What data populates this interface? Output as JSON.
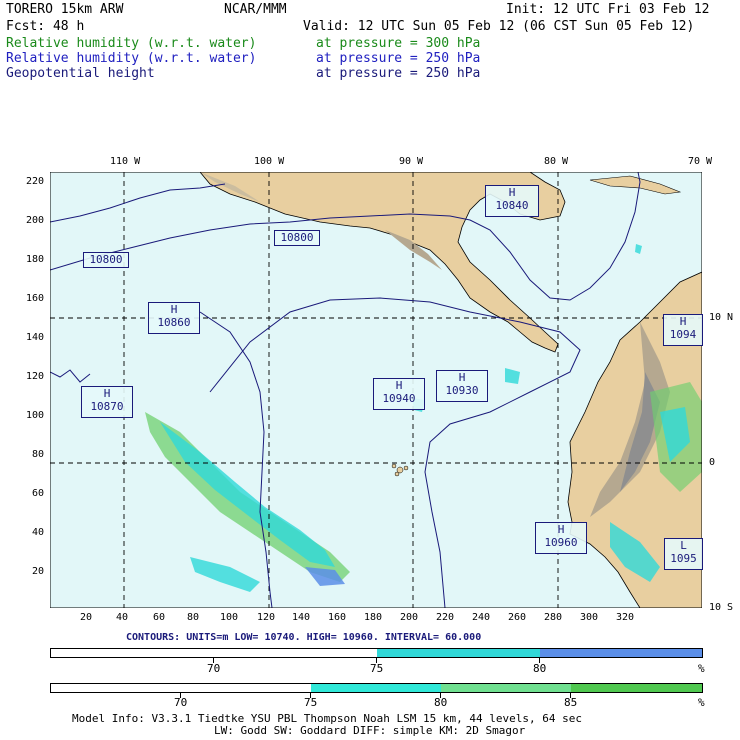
{
  "header": {
    "model": "TORERO  15km ARW",
    "org": "NCAR/MMM",
    "init": "Init: 12 UTC Fri 03 Feb 12",
    "fcst": "Fcst:   48 h",
    "valid": "Valid: 12 UTC Sun 05 Feb 12 (06 CST Sun 05 Feb 12)"
  },
  "fields": [
    {
      "name": "Relative humidity (w.r.t. water)",
      "level": "at pressure =  300 hPa",
      "color": "#1a8a1a"
    },
    {
      "name": "Relative humidity (w.r.t. water)",
      "level": "at pressure =  250 hPa",
      "color": "#2020c0"
    },
    {
      "name": "Geopotential height",
      "level": "at pressure =  250 hPa",
      "color": "#1a1a7a"
    }
  ],
  "map": {
    "top_lon_labels": [
      "110 W",
      "100 W",
      "90 W",
      "80 W",
      "70 W"
    ],
    "right_lat_labels": [
      "10 N",
      "0",
      "10 S"
    ],
    "y_ticks": [
      "220",
      "200",
      "180",
      "160",
      "140",
      "120",
      "100",
      "80",
      "60",
      "40",
      "20"
    ],
    "x_ticks": [
      "20",
      "40",
      "60",
      "80",
      "100",
      "120",
      "140",
      "160",
      "180",
      "200",
      "220",
      "240",
      "260",
      "280",
      "300",
      "320"
    ],
    "contour_labels": [
      {
        "id": "h-10840",
        "type": "H",
        "value": "10840"
      },
      {
        "id": "c-10800a",
        "type": "",
        "value": "10800"
      },
      {
        "id": "c-10800b",
        "type": "",
        "value": "10800"
      },
      {
        "id": "h-10860",
        "type": "H",
        "value": "10860"
      },
      {
        "id": "h-10870",
        "type": "H",
        "value": "10870"
      },
      {
        "id": "h-10940",
        "type": "H",
        "value": "10940"
      },
      {
        "id": "h-10930",
        "type": "H",
        "value": "10930"
      },
      {
        "id": "h-10960",
        "type": "H",
        "value": "10960"
      },
      {
        "id": "h-1094x",
        "type": "H",
        "value": "1094"
      },
      {
        "id": "l-1095x",
        "type": "L",
        "value": "1095"
      }
    ],
    "colors": {
      "ocean": "#e2f7f8",
      "land": "#e8cfa0",
      "terrain": "#b5a890",
      "rh_green": "#6fd06f",
      "rh_cyan": "#30d8d8",
      "rh_blue": "#5a8ee8"
    }
  },
  "contours_info": {
    "text": "CONTOURS: UNITS=m  LOW= 10740.    HIGH= 10960.    INTERVAL=  60.000"
  },
  "colorbar_1": {
    "labels": [
      "70",
      "75",
      "80"
    ],
    "unit": "%",
    "colors": [
      "#ffffff",
      "#30d8d8",
      "#5a8ee8"
    ]
  },
  "colorbar_2": {
    "labels": [
      "70",
      "75",
      "80",
      "85"
    ],
    "unit": "%",
    "colors": [
      "#ffffff",
      "#30e8d8",
      "#70e090",
      "#50c850"
    ]
  },
  "footer": {
    "line1": "Model Info: V3.3.1   Tiedtke YSU PBL  Thompson    Noah LSM  15 km,   44 levels,   64 sec",
    "line2": "LW: Godd SW: Goddard DIFF: simple KM: 2D Smagor"
  }
}
